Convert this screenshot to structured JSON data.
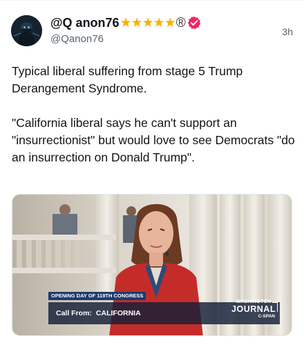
{
  "post": {
    "display_name": "@Q anon76",
    "name_stars": "★★★★★",
    "name_reg": "®",
    "handle": "@Qanon76",
    "time": "3h",
    "text": "Typical liberal suffering from stage 5 Trump Derangement Syndrome.\n\n\"California liberal says he can't support an \"insurrectionist\" but would love to see Democrats \"do an insurrection on Donald Trump\".",
    "icons": {
      "avatar": "avatar-image",
      "verified": "verified-badge-icon"
    },
    "colors": {
      "verified": "#f4245e",
      "stars": "#f5b400",
      "handle": "#536471"
    }
  },
  "media": {
    "banner_top": "OPENING DAY OF 119TH CONGRESS",
    "call_label": "Call From:",
    "call_value": "CALIFORNIA",
    "logo_line1": "WASHINGTON",
    "logo_line2": "JOURNAL",
    "logo_line3": "C-SPAN"
  }
}
